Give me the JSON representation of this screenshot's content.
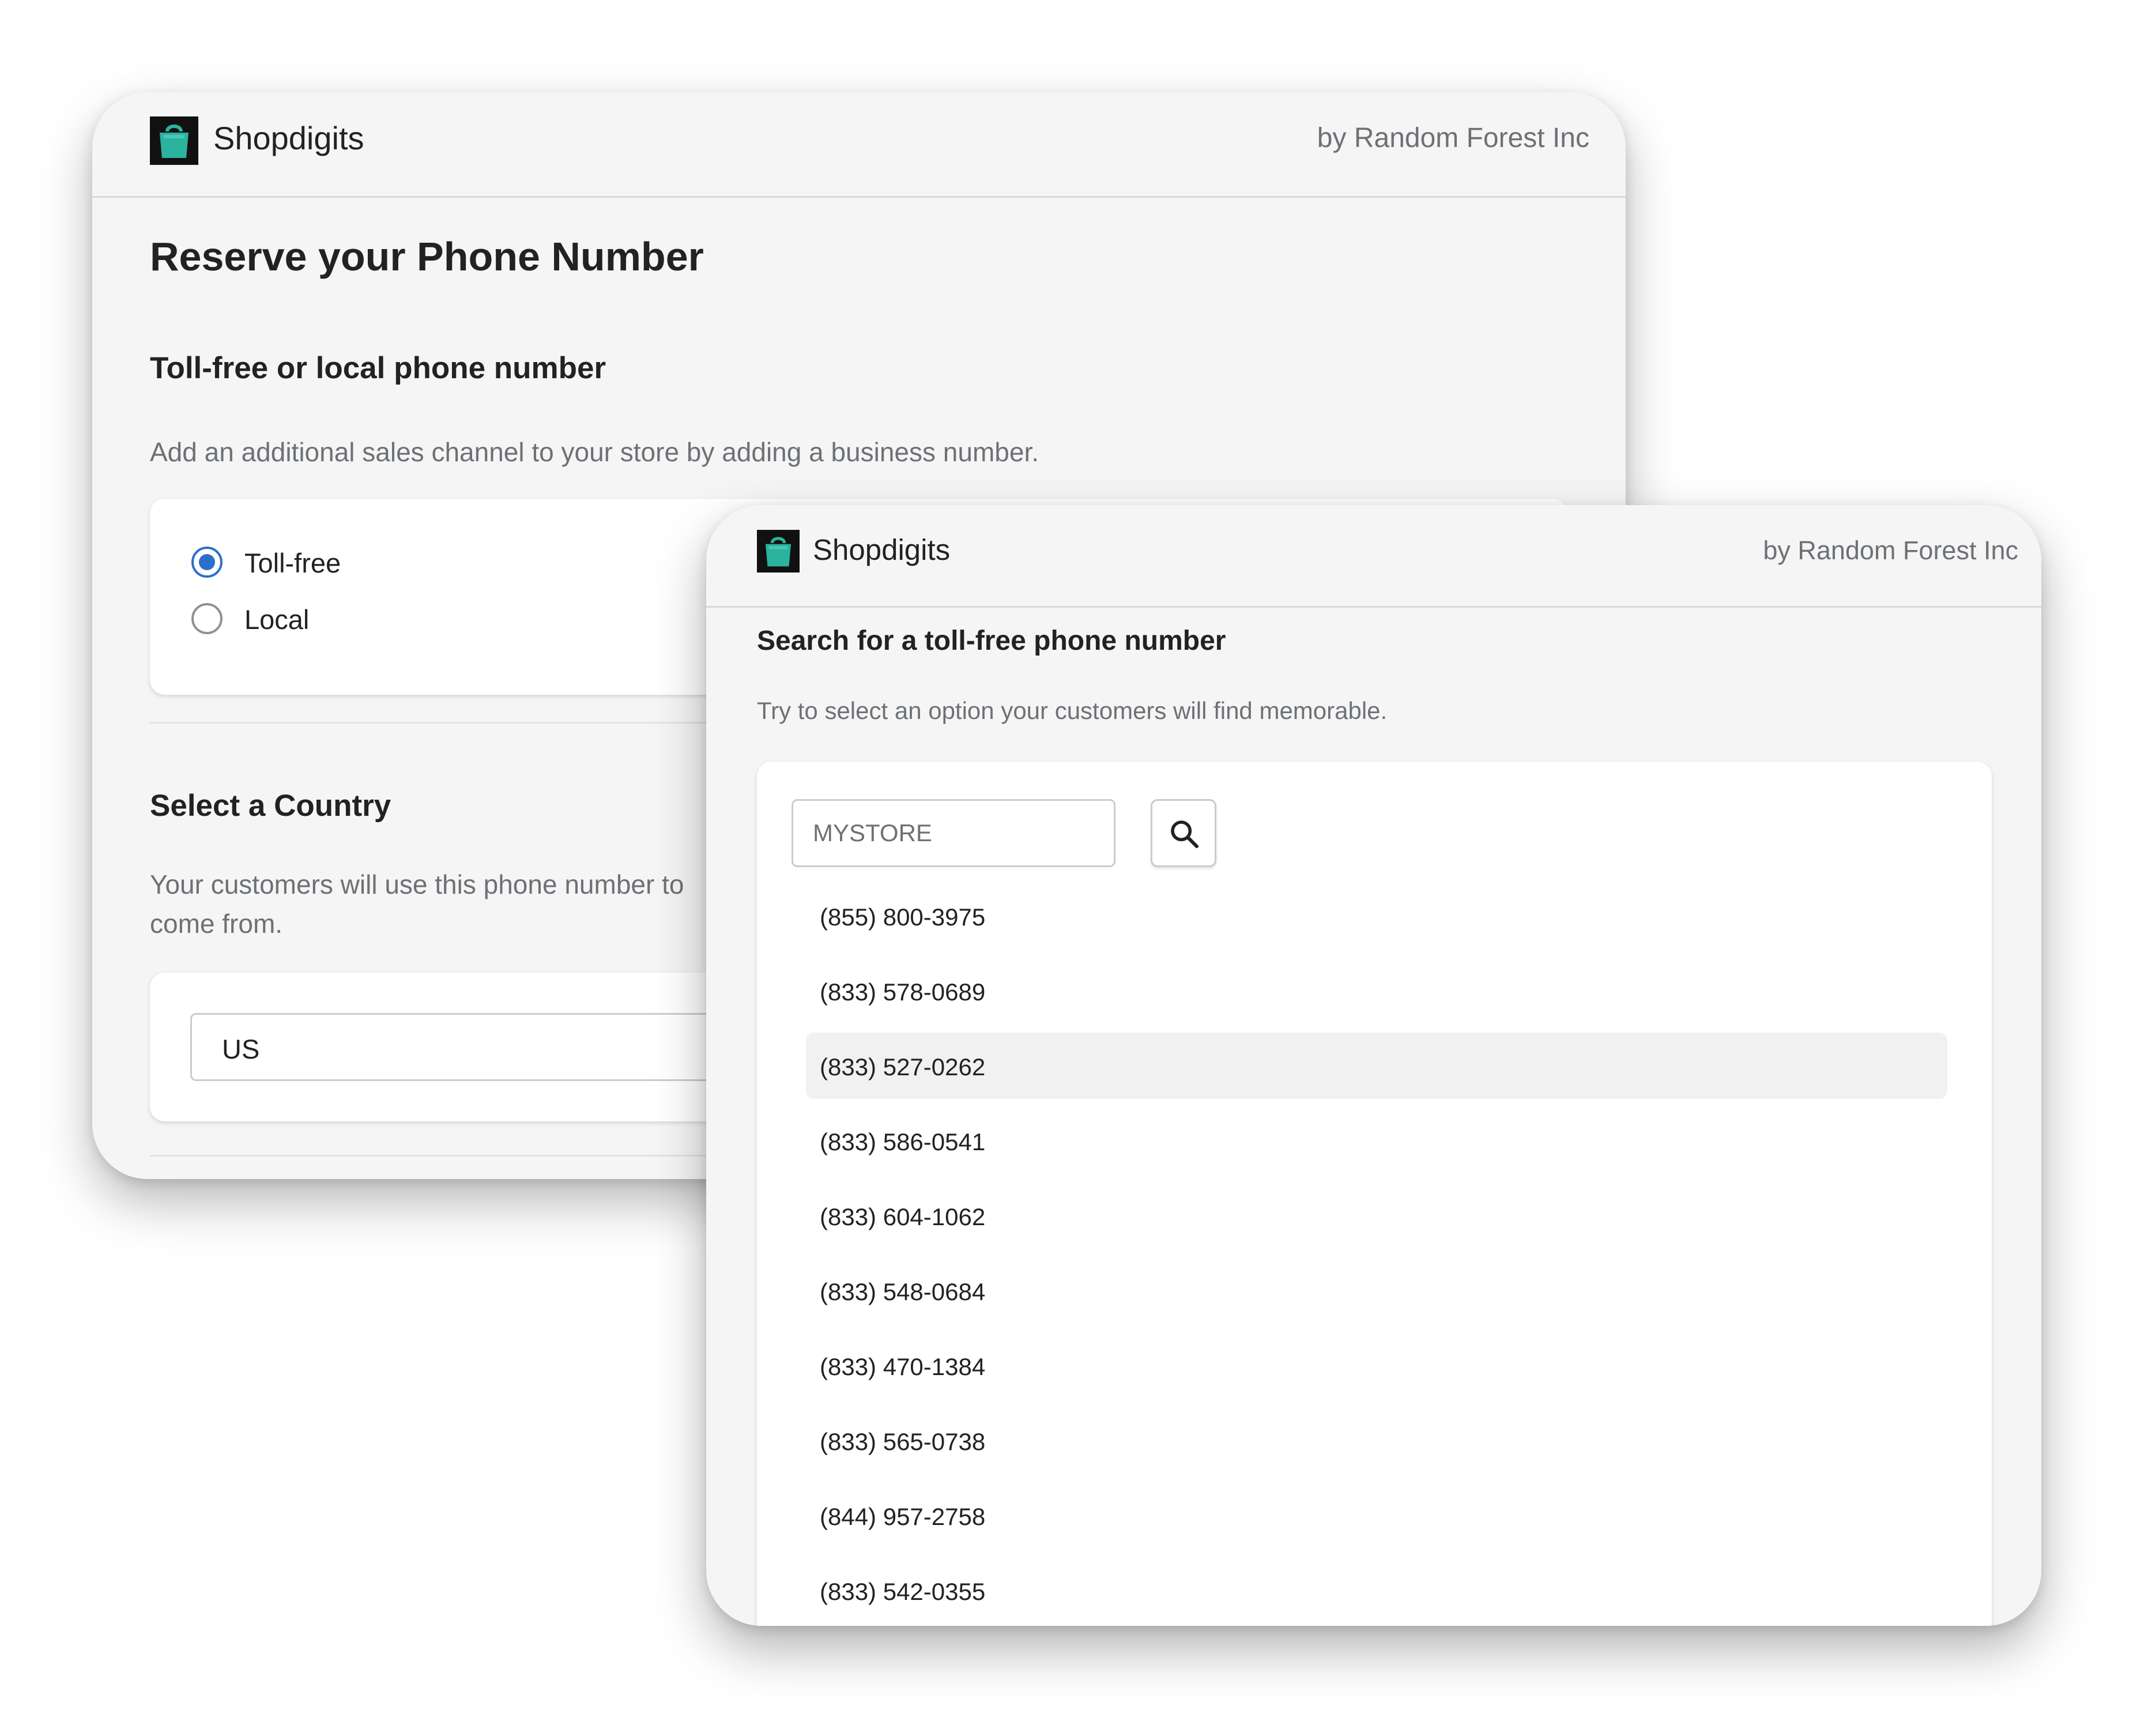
{
  "back_window": {
    "header": {
      "app_name": "Shopdigits",
      "by_line": "by Random Forest Inc",
      "logo_icon": "shopping-bag-icon"
    },
    "title": "Reserve your Phone Number",
    "type_section": {
      "heading": "Toll-free or local phone number",
      "description": "Add an additional sales channel to your store by adding a business number.",
      "options": [
        {
          "label": "Toll-free",
          "selected": true
        },
        {
          "label": "Local",
          "selected": false
        }
      ]
    },
    "country_section": {
      "heading": "Select a Country",
      "description_line1": "Your customers will use this phone number to",
      "description_line2": "come from.",
      "selected_country": "US"
    }
  },
  "front_window": {
    "header": {
      "app_name": "Shopdigits",
      "by_line": "by Random Forest Inc",
      "logo_icon": "shopping-bag-icon"
    },
    "heading": "Search for a toll-free phone number",
    "description": "Try to select an option your customers will find memorable.",
    "search": {
      "value": "MYSTORE",
      "button_icon": "search-icon"
    },
    "numbers": [
      "(855) 800-3975",
      "(833) 578-0689",
      "(833) 527-0262",
      "(833) 586-0541",
      "(833) 604-1062",
      "(833) 548-0684",
      "(833) 470-1384",
      "(833) 565-0738",
      "(844) 957-2758",
      "(833) 542-0355"
    ],
    "highlighted_number": "(833) 527-0262"
  },
  "colors": {
    "logo_bag": "#2bb3a0",
    "logo_bg": "#111111",
    "radio_selected": "#2c6ecb",
    "window_bg": "#f5f5f5",
    "card_bg": "#ffffff",
    "muted_text": "#6d7175"
  }
}
